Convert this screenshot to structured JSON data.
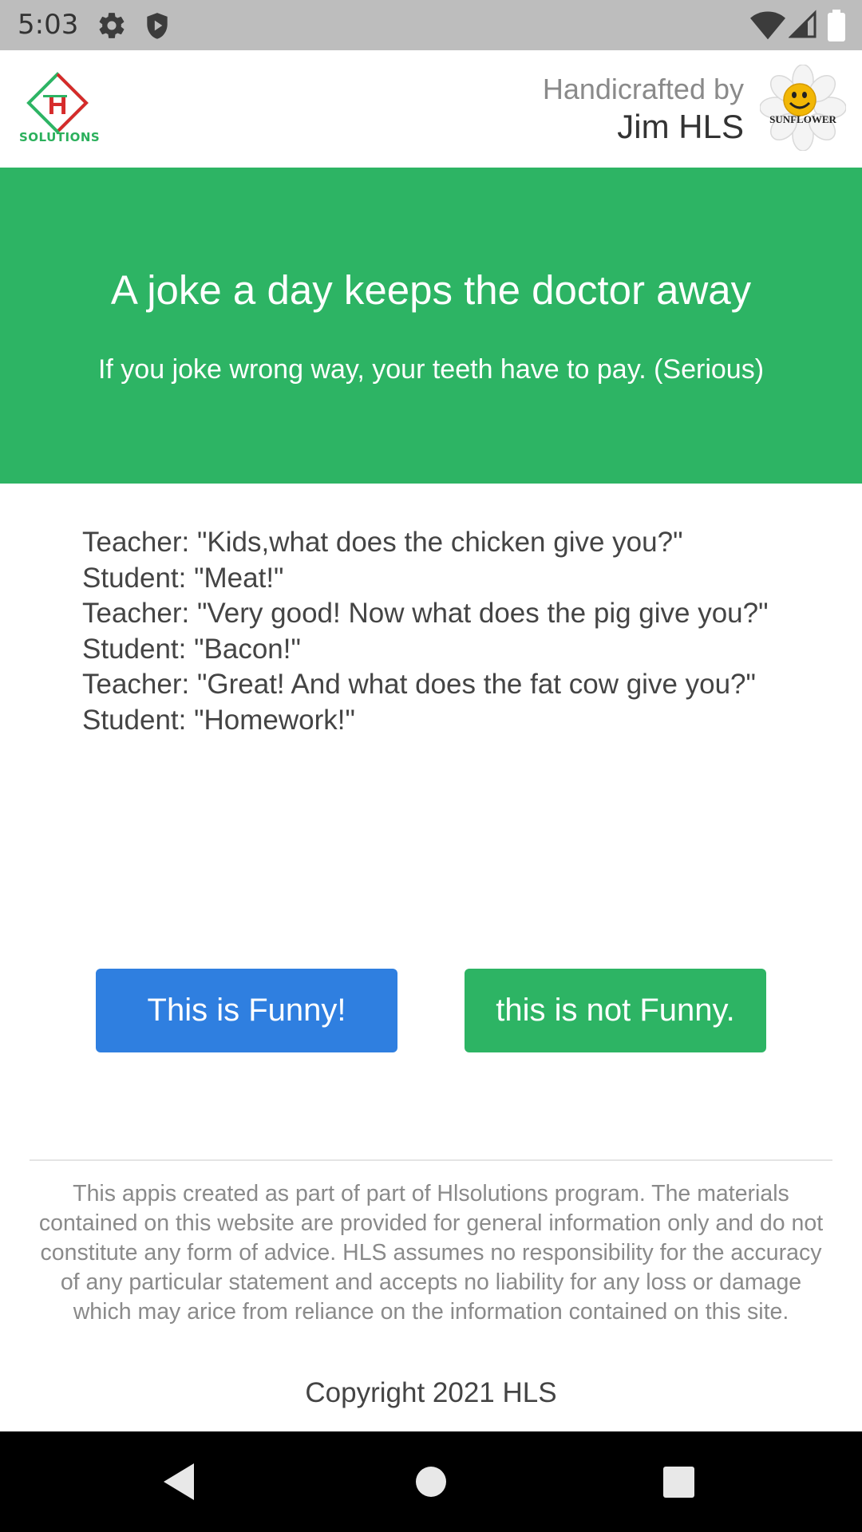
{
  "status_bar": {
    "time": "5:03",
    "icons": [
      "gear-icon",
      "shield-icon",
      "wifi-icon",
      "signal-icon",
      "battery-icon"
    ]
  },
  "header": {
    "logo_text": "SOLUTIONS",
    "credit_label": "Handicrafted by",
    "credit_name": "Jim HLS",
    "sunflower_text": "SUNFLOWER"
  },
  "hero": {
    "title": "A joke a day keeps the doctor away",
    "subtitle": "If you joke wrong way, your teeth have to pay. (Serious)",
    "background": "#2db464"
  },
  "joke": {
    "lines": [
      "Teacher: \"Kids,what does the chicken give you?\"",
      "Student: \"Meat!\"",
      "Teacher: \"Very good! Now what does the pig give you?\"",
      "Student: \"Bacon!\"",
      "Teacher: \"Great! And what does the fat cow give you?\"",
      "Student: \"Homework!\""
    ]
  },
  "buttons": {
    "funny_label": "This is Funny!",
    "not_funny_label": "this is not Funny.",
    "funny_color": "#2f7fe0",
    "not_funny_color": "#2db464"
  },
  "footer": {
    "disclaimer": "This appis created as part of part of Hlsolutions program. The materials contained on this website are provided for general information only and do not constitute any form of advice. HLS assumes no responsibility for the accuracy of any particular statement and accepts no liability for any loss or damage which may arice from reliance on the information contained on this site.",
    "copyright": "Copyright 2021 HLS"
  },
  "nav_bar": {
    "buttons": [
      "back-icon",
      "home-icon",
      "recents-icon"
    ]
  }
}
